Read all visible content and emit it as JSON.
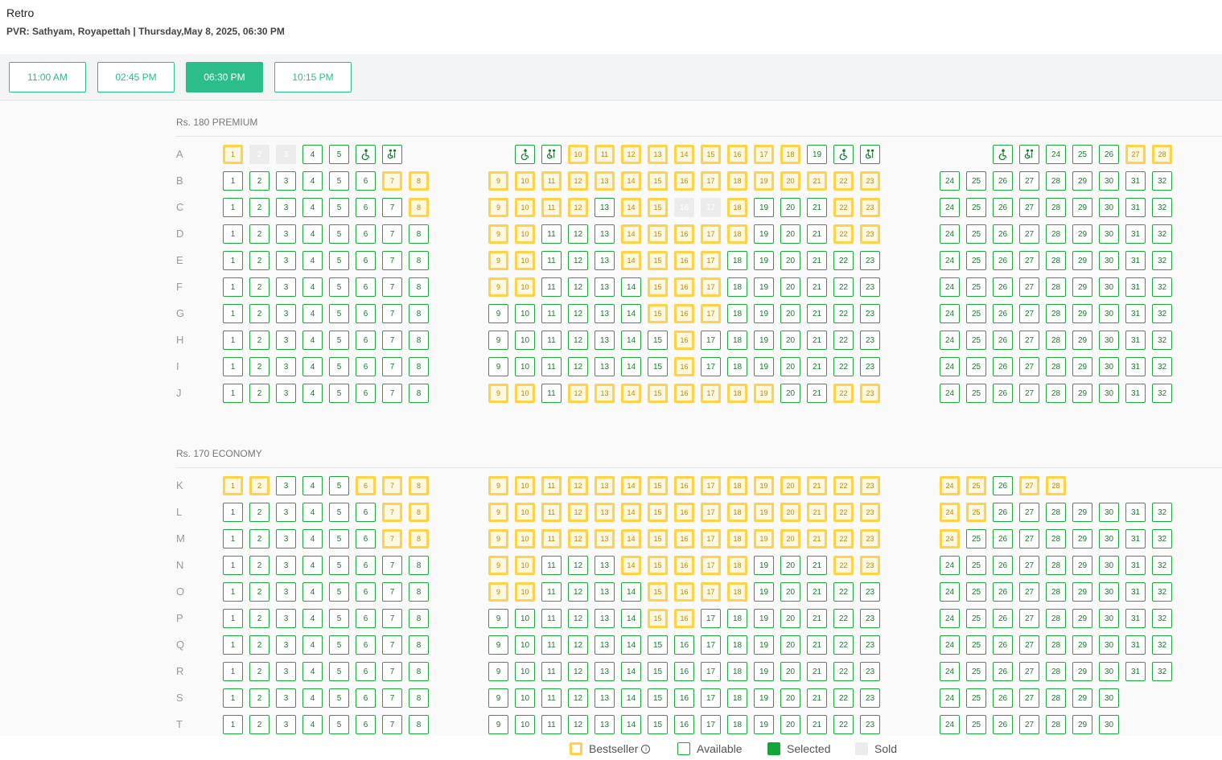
{
  "header": {
    "title": "Retro",
    "subtitle": "PVR: Sathyam, Royapettah | Thursday,May 8, 2025, 06:30 PM"
  },
  "showtimes": [
    {
      "label": "11:00 AM",
      "active": false
    },
    {
      "label": "02:45 PM",
      "active": false
    },
    {
      "label": "06:30 PM",
      "active": true
    },
    {
      "label": "10:15 PM",
      "active": false
    }
  ],
  "colors": {
    "accent": "#2bbd8a",
    "seat_border": "#1ea83c",
    "bestseller": "#ffd24a",
    "selected": "#13a53a",
    "sold": "#ececec"
  },
  "sections": [
    {
      "label": "Rs. 180 PREMIUM",
      "rows": [
        {
          "row": "A",
          "seats": [
            [
              "1",
              "b"
            ],
            [
              "2",
              "s"
            ],
            [
              "3",
              "s"
            ],
            [
              "4",
              "a"
            ],
            [
              "5",
              "a"
            ],
            [
              "wheelchair-icon",
              "w"
            ],
            [
              "companion-icon",
              "c"
            ],
            "|",
            [
              "wheelchair-icon",
              "w"
            ],
            [
              "companion-icon",
              "c"
            ],
            [
              "10",
              "b"
            ],
            [
              "11",
              "b"
            ],
            [
              "12",
              "b"
            ],
            [
              "13",
              "b"
            ],
            [
              "14",
              "b"
            ],
            [
              "15",
              "b"
            ],
            [
              "16",
              "b"
            ],
            [
              "17",
              "b"
            ],
            [
              "18",
              "b"
            ],
            [
              "19",
              "a"
            ],
            [
              "wheelchair-icon",
              "w"
            ],
            [
              "companion-icon",
              "c"
            ],
            "|",
            [
              "wheelchair-icon",
              "w"
            ],
            [
              "companion-icon",
              "c"
            ],
            [
              "24",
              "a"
            ],
            [
              "25",
              "a"
            ],
            [
              "26",
              "a"
            ],
            [
              "27",
              "b"
            ],
            [
              "28",
              "b"
            ]
          ]
        },
        {
          "row": "B",
          "bs": [
            7,
            8,
            9,
            10,
            11,
            12,
            13,
            14,
            15,
            16,
            17,
            18,
            19,
            20,
            21,
            22,
            23
          ],
          "sold": []
        },
        {
          "row": "C",
          "bs": [
            8,
            9,
            10,
            11,
            12,
            14,
            15,
            18,
            22,
            23
          ],
          "sold": [
            16,
            17
          ]
        },
        {
          "row": "D",
          "bs": [
            9,
            10,
            14,
            15,
            16,
            17,
            18,
            22,
            23
          ],
          "sold": []
        },
        {
          "row": "E",
          "bs": [
            9,
            10,
            14,
            15,
            16,
            17
          ],
          "sold": []
        },
        {
          "row": "F",
          "bs": [
            9,
            10,
            15,
            16,
            17
          ],
          "sold": []
        },
        {
          "row": "G",
          "bs": [
            15,
            16,
            17
          ],
          "sold": []
        },
        {
          "row": "H",
          "bs": [
            16
          ],
          "sold": []
        },
        {
          "row": "I",
          "bs": [
            16
          ],
          "sold": []
        },
        {
          "row": "J",
          "bs": [
            9,
            10,
            12,
            13,
            14,
            15,
            16,
            17,
            18,
            19,
            22,
            23
          ],
          "sold": []
        }
      ]
    },
    {
      "label": "Rs. 170 ECONOMY",
      "rows": [
        {
          "row": "K",
          "max": 28,
          "bs": [
            1,
            2,
            6,
            7,
            8,
            9,
            10,
            11,
            12,
            13,
            14,
            15,
            16,
            17,
            18,
            19,
            20,
            21,
            22,
            23,
            24,
            25,
            27,
            28
          ],
          "sold": []
        },
        {
          "row": "L",
          "bs": [
            7,
            8,
            9,
            10,
            11,
            12,
            13,
            14,
            15,
            16,
            17,
            18,
            19,
            20,
            21,
            22,
            23,
            24,
            25
          ],
          "sold": []
        },
        {
          "row": "M",
          "bs": [
            7,
            8,
            9,
            10,
            11,
            12,
            13,
            14,
            15,
            16,
            17,
            18,
            19,
            20,
            21,
            22,
            23,
            24
          ],
          "sold": []
        },
        {
          "row": "N",
          "bs": [
            9,
            10,
            14,
            15,
            16,
            17,
            18,
            22,
            23
          ],
          "sold": []
        },
        {
          "row": "O",
          "bs": [
            9,
            10,
            15,
            16,
            17,
            18
          ],
          "sold": []
        },
        {
          "row": "P",
          "bs": [
            15,
            16
          ],
          "sold": []
        },
        {
          "row": "Q",
          "bs": [],
          "sold": []
        },
        {
          "row": "R",
          "bs": [],
          "sold": []
        },
        {
          "row": "S",
          "max": 30,
          "bs": [],
          "sold": []
        },
        {
          "row": "T",
          "max": 30,
          "bs": [],
          "sold": []
        }
      ]
    }
  ],
  "legend": {
    "bestseller": "Bestseller",
    "info_icon": "i",
    "available": "Available",
    "selected": "Selected",
    "sold": "Sold"
  }
}
